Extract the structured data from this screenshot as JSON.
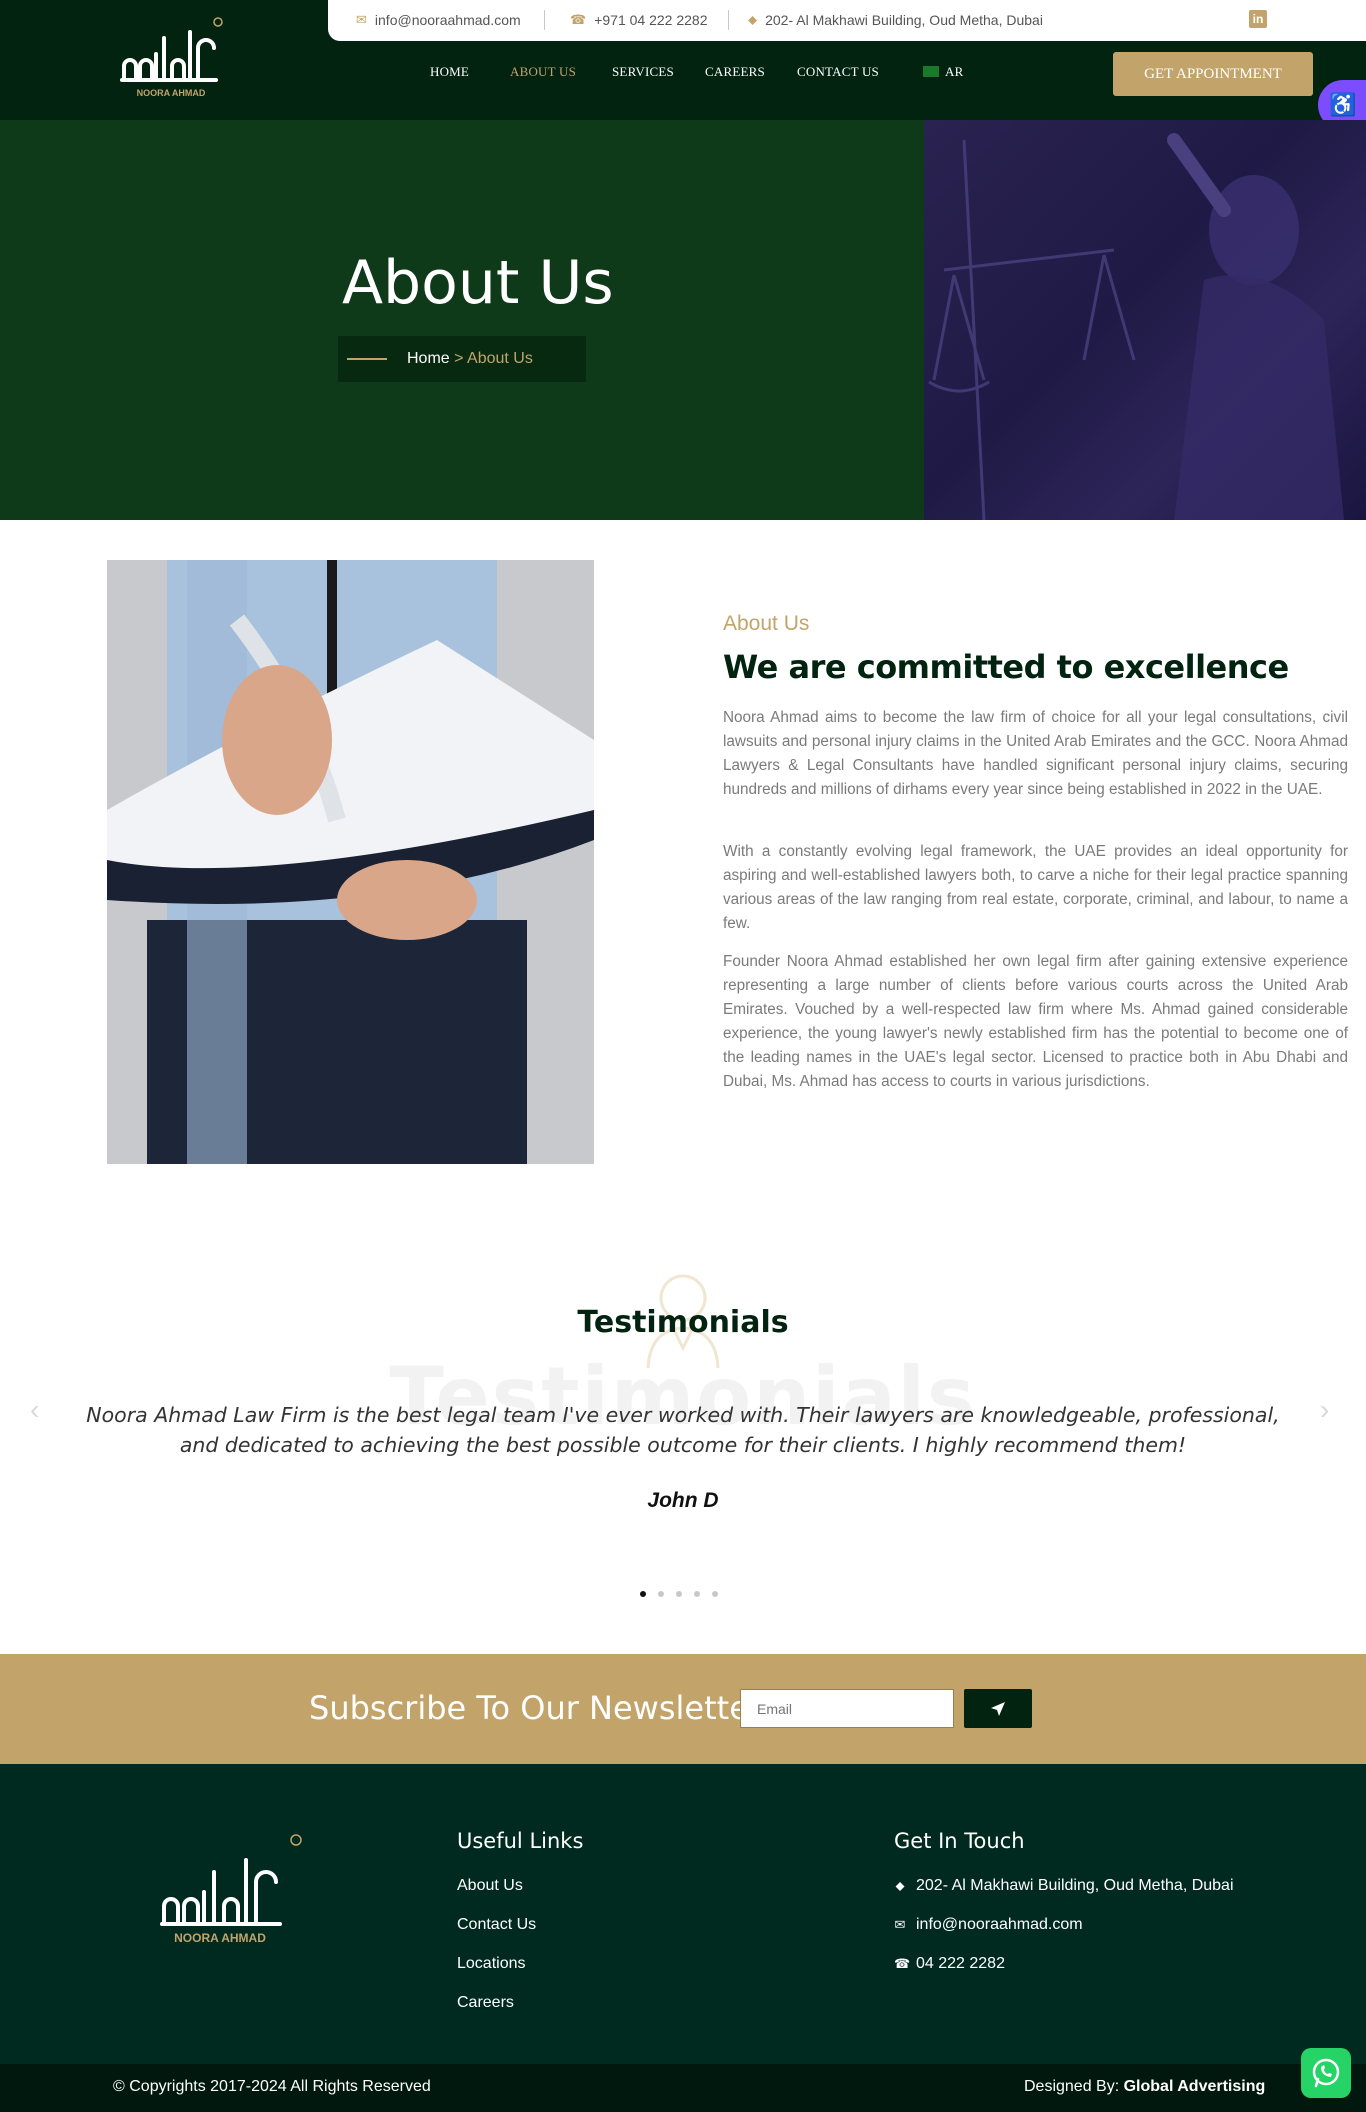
{
  "header": {
    "topbar": {
      "email": "info@nooraahmad.com",
      "phone": "+971 04 222 2282",
      "address": "202- Al Makhawi Building, Oud Metha, Dubai",
      "social_icon": "linkedin-icon"
    },
    "logo": {
      "brand": "NOORA AHMAD"
    },
    "nav": [
      {
        "label": "HOME"
      },
      {
        "label": "ABOUT US",
        "active": true
      },
      {
        "label": "SERVICES"
      },
      {
        "label": "CAREERS"
      },
      {
        "label": "CONTACT US"
      },
      {
        "label": "AR"
      }
    ],
    "cta_label": "GET APPOINTMENT"
  },
  "hero": {
    "title": "About Us",
    "breadcrumb_home": "Home",
    "breadcrumb_sep": " > ",
    "breadcrumb_current": "About Us"
  },
  "about": {
    "subtitle": "About Us",
    "title": "We are committed to excellence",
    "paragraphs": [
      "Noora Ahmad aims to become the law firm of choice for all your legal consultations, civil lawsuits and personal injury claims in the United Arab Emirates and the GCC. Noora Ahmad Lawyers & Legal Consultants have handled significant personal injury claims, securing hundreds and millions of dirhams every year since being established in 2022 in the UAE.",
      "With a constantly evolving legal framework, the UAE provides an ideal opportunity for aspiring and well-established lawyers both, to carve a niche for their legal practice spanning various areas of the law ranging from real estate, corporate, criminal, and labour, to name a few.",
      "Founder Noora Ahmad established her own legal firm after gaining extensive experience representing a large number of clients before various courts across the United Arab Emirates. Vouched by a well-respected law firm where Ms. Ahmad gained considerable experience, the young lawyer's newly established firm has the potential to become one of the leading names in the UAE's legal sector. Licensed to practice both in Abu Dhabi and Dubai, Ms. Ahmad has access to courts in various jurisdictions."
    ]
  },
  "testimonials": {
    "title": "Testimonials",
    "watermark": "Testimonials",
    "quote": "Noora Ahmad Law Firm is the best legal team I've ever worked with. Their lawyers are knowledgeable, professional, and dedicated to achieving the best possible outcome for their clients. I highly recommend them!",
    "author": "John D",
    "slide_count": 5,
    "active_slide": 1
  },
  "newsletter": {
    "title": "Subscribe To Our Newsletter",
    "email_placeholder": "Email"
  },
  "footer": {
    "useful_links_title": "Useful Links",
    "links": [
      "About Us",
      "Contact Us",
      "Locations",
      "Careers"
    ],
    "get_in_touch_title": "Get In Touch",
    "address": "202- Al Makhawi Building, Oud Metha, Dubai",
    "email": "info@nooraahmad.com",
    "phone": "04 222 2282",
    "copyright": "© Copyrights 2017-2024 All Rights Reserved",
    "designed_by_prefix": "Designed By: ",
    "designed_by_name": "Global Advertising"
  },
  "colors": {
    "brand_dark_green": "#012310",
    "gold": "#c2a46a",
    "footer_green": "#00291f"
  }
}
